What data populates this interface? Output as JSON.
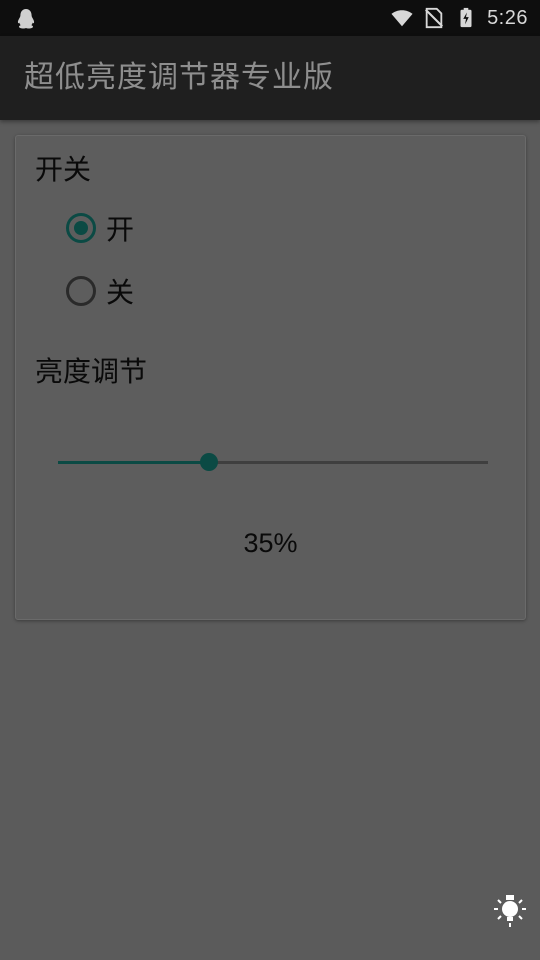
{
  "status_bar": {
    "time": "5:26",
    "icons": [
      "qq-penguin-icon",
      "wifi-icon",
      "no-sim-icon",
      "battery-charging-icon"
    ]
  },
  "app_bar": {
    "title": "超低亮度调节器专业版"
  },
  "switch_section": {
    "label": "开关",
    "options": [
      {
        "label": "开",
        "checked": true
      },
      {
        "label": "关",
        "checked": false
      }
    ]
  },
  "brightness_section": {
    "label": "亮度调节",
    "value_fraction": 0.35,
    "value_text": "35%"
  },
  "floating_button": {
    "icon": "brightness-bulb-icon"
  },
  "colors": {
    "accent": "#0b4a44",
    "background": "#5b5b5b",
    "app_bar": "#1f1f1f",
    "status_bar": "#0e0e0e"
  }
}
